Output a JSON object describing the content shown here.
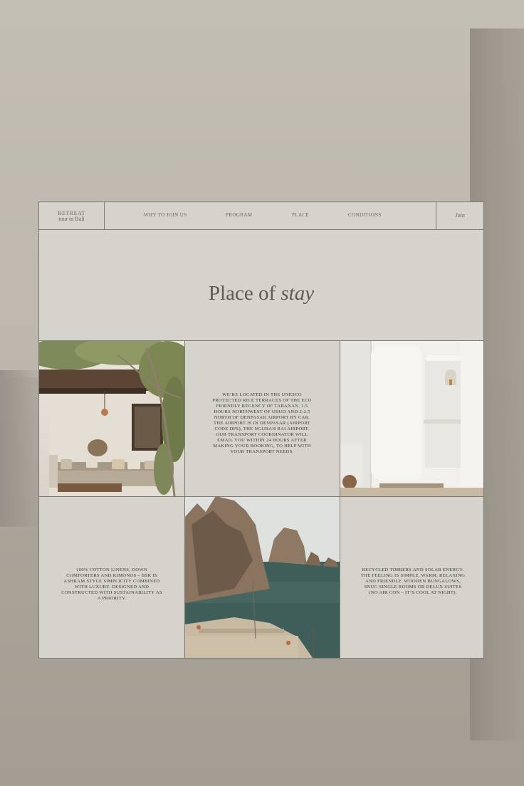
{
  "brand": {
    "line1": "RETREAT",
    "line2": "tour to Bali"
  },
  "nav": {
    "links": [
      "WHY TO JOIN US",
      "PROGRAM",
      "PLACE",
      "CONDITIONS"
    ],
    "join_label": "Join"
  },
  "hero": {
    "title_plain": "Place of ",
    "title_italic": "stay"
  },
  "blocks": {
    "location": "We’re located in the UNESCO protected rice terraces of the eco friendly Regency of Tabanan. 1.5 hours northwest of Ubud and 2-2.5 north of Denpasar airport by car. The airport is in Denpasar (airport code DPS), the Ngurah Rai Airport. Our transport coordinator will email you within 24 hours after making your booking, to help with your transport needs.",
    "linens": "100% cotton linens, down comforters and kimonos – BSR is Ashram style simplicity combined with luxury. Designed and constructed with sustainability as a priority.",
    "timbers": "Recycled timbers and solar energy. The feeling is simple, warm, relaxing and friendly. Wooden bungalows, snug single rooms or delux suites (no air con – it’s cool at night)."
  },
  "images": [
    "terrace-lounge-photo",
    "white-bathroom-photo",
    "coastal-rocks-photo"
  ]
}
